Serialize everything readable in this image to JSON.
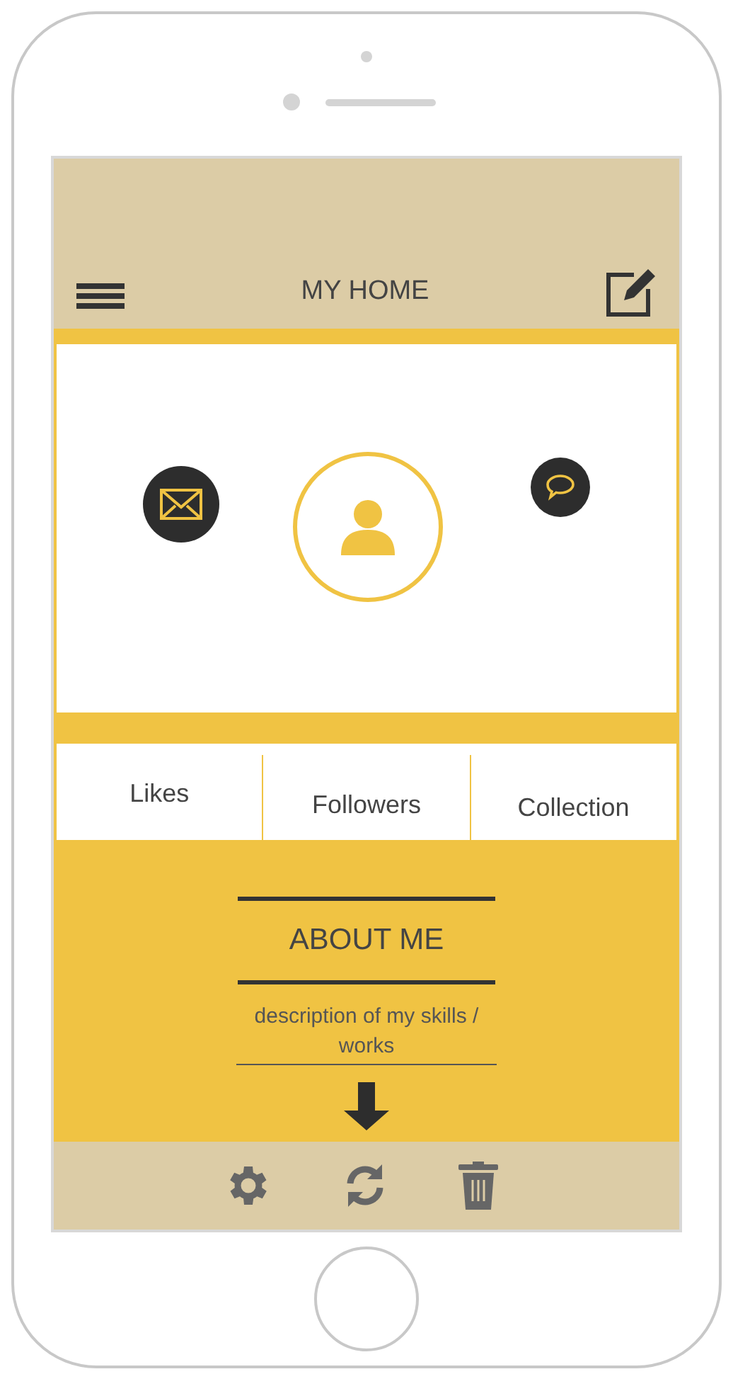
{
  "header": {
    "title": "MY HOME"
  },
  "stats": [
    {
      "label": "Likes"
    },
    {
      "label": "Followers"
    },
    {
      "label": "Collection"
    }
  ],
  "about": {
    "title": "ABOUT ME",
    "description": "description of my skills / works"
  }
}
